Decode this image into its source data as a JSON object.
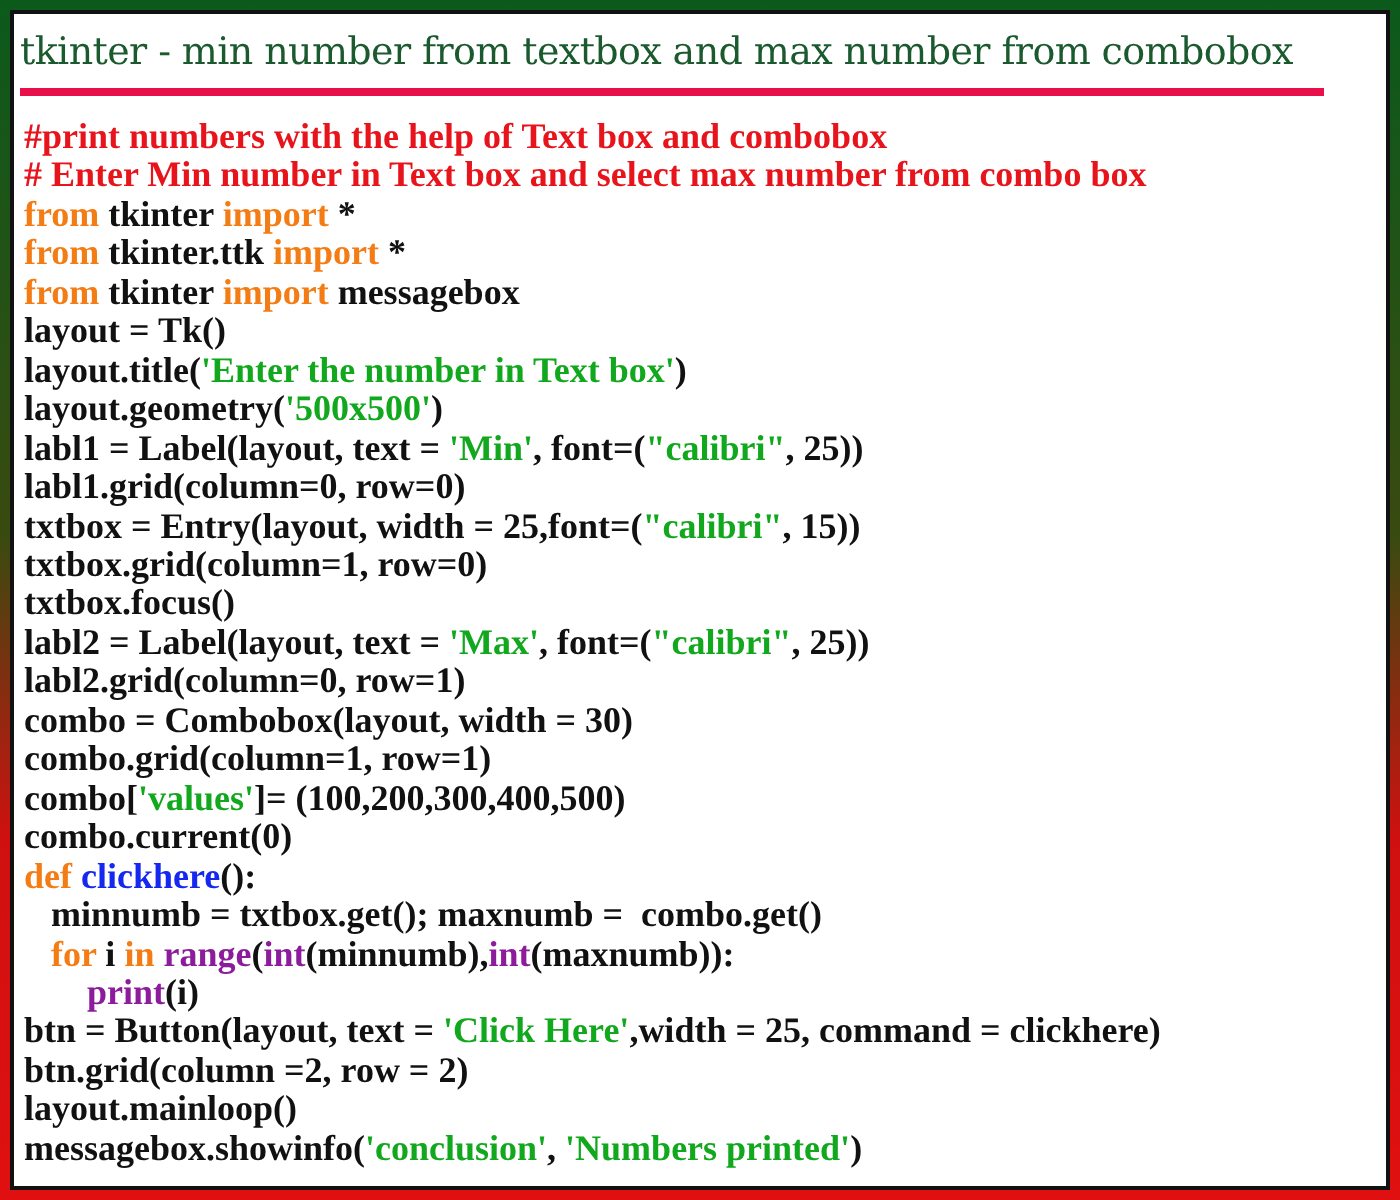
{
  "title": "tkinter - min number from textbox and max number from combobox",
  "code_lines": [
    [
      {
        "text": "#print numbers with the help of Text box and combobox",
        "kind": "comment"
      }
    ],
    [
      {
        "text": "# Enter Min number in Text box and select max number from combo box",
        "kind": "comment"
      }
    ],
    [
      {
        "text": "from",
        "kind": "keyword"
      },
      {
        "text": " tkinter ",
        "kind": "plain"
      },
      {
        "text": "import",
        "kind": "keyword"
      },
      {
        "text": " *",
        "kind": "plain"
      }
    ],
    [
      {
        "text": "from",
        "kind": "keyword"
      },
      {
        "text": " tkinter.ttk ",
        "kind": "plain"
      },
      {
        "text": "import",
        "kind": "keyword"
      },
      {
        "text": " *",
        "kind": "plain"
      }
    ],
    [
      {
        "text": "from",
        "kind": "keyword"
      },
      {
        "text": " tkinter ",
        "kind": "plain"
      },
      {
        "text": "import",
        "kind": "keyword"
      },
      {
        "text": " messagebox",
        "kind": "plain"
      }
    ],
    [
      {
        "text": "layout = Tk()",
        "kind": "plain"
      }
    ],
    [
      {
        "text": "layout.title(",
        "kind": "plain"
      },
      {
        "text": "'Enter the number in Text box'",
        "kind": "string"
      },
      {
        "text": ")",
        "kind": "plain"
      }
    ],
    [
      {
        "text": "layout.geometry(",
        "kind": "plain"
      },
      {
        "text": "'500x500'",
        "kind": "string"
      },
      {
        "text": ")",
        "kind": "plain"
      }
    ],
    [
      {
        "text": "labl1 = Label(layout, text = ",
        "kind": "plain"
      },
      {
        "text": "'Min'",
        "kind": "string"
      },
      {
        "text": ", font=(",
        "kind": "plain"
      },
      {
        "text": "\"calibri\"",
        "kind": "string"
      },
      {
        "text": ", 25))",
        "kind": "plain"
      }
    ],
    [
      {
        "text": "labl1.grid(column=0, row=0)",
        "kind": "plain"
      }
    ],
    [
      {
        "text": "txtbox = Entry(layout, width = 25,font=(",
        "kind": "plain"
      },
      {
        "text": "\"calibri\"",
        "kind": "string"
      },
      {
        "text": ", 15))",
        "kind": "plain"
      }
    ],
    [
      {
        "text": "txtbox.grid(column=1, row=0)",
        "kind": "plain"
      }
    ],
    [
      {
        "text": "txtbox.focus()",
        "kind": "plain"
      }
    ],
    [
      {
        "text": "labl2 = Label(layout, text = ",
        "kind": "plain"
      },
      {
        "text": "'Max'",
        "kind": "string"
      },
      {
        "text": ", font=(",
        "kind": "plain"
      },
      {
        "text": "\"calibri\"",
        "kind": "string"
      },
      {
        "text": ", 25))",
        "kind": "plain"
      }
    ],
    [
      {
        "text": "labl2.grid(column=0, row=1)",
        "kind": "plain"
      }
    ],
    [
      {
        "text": "combo = Combobox(layout, width = 30)",
        "kind": "plain"
      }
    ],
    [
      {
        "text": "combo.grid(column=1, row=1)",
        "kind": "plain"
      }
    ],
    [
      {
        "text": "combo[",
        "kind": "plain"
      },
      {
        "text": "'values'",
        "kind": "string"
      },
      {
        "text": "]= (100,200,300,400,500)",
        "kind": "plain"
      }
    ],
    [
      {
        "text": "combo.current(0)",
        "kind": "plain"
      }
    ],
    [
      {
        "text": "def",
        "kind": "keyword"
      },
      {
        "text": " clickhere",
        "kind": "function"
      },
      {
        "text": "():",
        "kind": "plain"
      }
    ],
    [
      {
        "text": "   minnumb = txtbox.get(); maxnumb =  combo.get()",
        "kind": "plain"
      }
    ],
    [
      {
        "text": "   for",
        "kind": "keyword"
      },
      {
        "text": " i ",
        "kind": "plain"
      },
      {
        "text": "in",
        "kind": "keyword"
      },
      {
        "text": " range",
        "kind": "builtin"
      },
      {
        "text": "(",
        "kind": "plain"
      },
      {
        "text": "int",
        "kind": "builtin"
      },
      {
        "text": "(minnumb),",
        "kind": "plain"
      },
      {
        "text": "int",
        "kind": "builtin"
      },
      {
        "text": "(maxnumb)):",
        "kind": "plain"
      }
    ],
    [
      {
        "text": "       print",
        "kind": "builtin"
      },
      {
        "text": "(i)",
        "kind": "plain"
      }
    ],
    [
      {
        "text": "btn = Button(layout, text = ",
        "kind": "plain"
      },
      {
        "text": "'Click Here'",
        "kind": "string"
      },
      {
        "text": ",width = 25, command = clickhere)",
        "kind": "plain"
      }
    ],
    [
      {
        "text": "btn.grid(column =2, row = 2)",
        "kind": "plain"
      }
    ],
    [
      {
        "text": "layout.mainloop()",
        "kind": "plain"
      }
    ],
    [
      {
        "text": "messagebox.showinfo(",
        "kind": "plain"
      },
      {
        "text": "'conclusion'",
        "kind": "string"
      },
      {
        "text": ", ",
        "kind": "plain"
      },
      {
        "text": "'Numbers printed'",
        "kind": "string"
      },
      {
        "text": ")",
        "kind": "plain"
      }
    ]
  ]
}
